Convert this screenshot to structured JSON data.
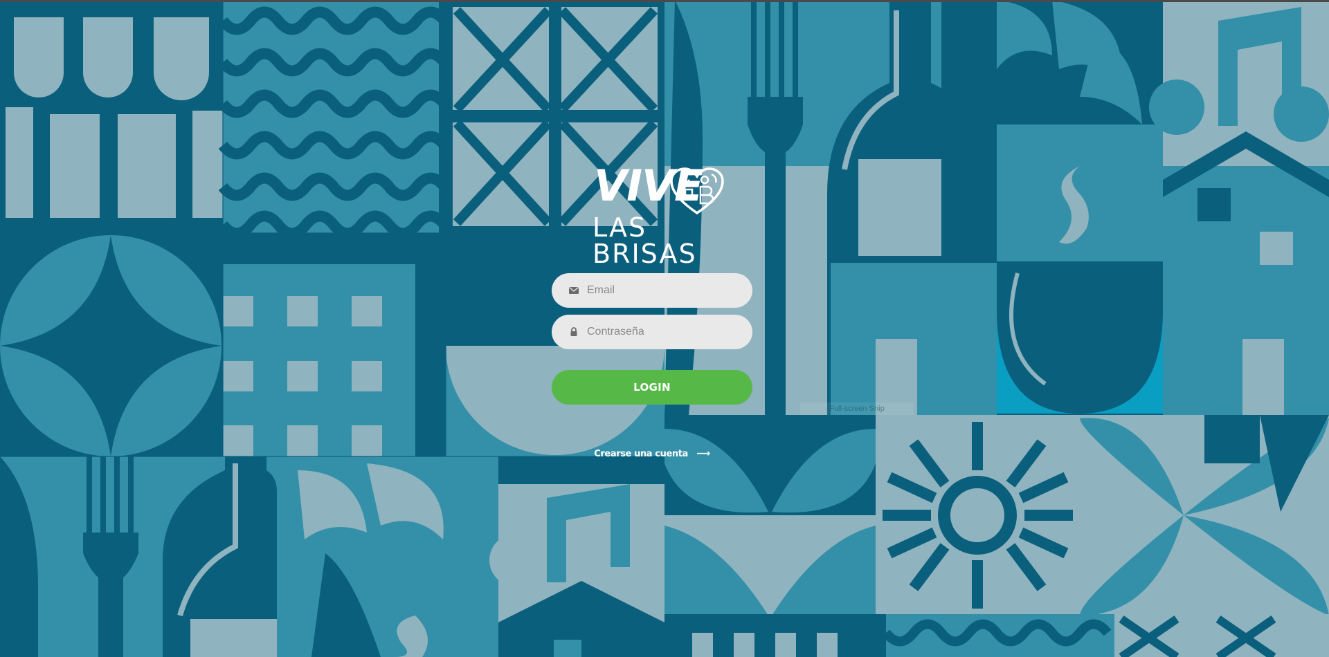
{
  "brand": {
    "logo_line1": "VIVE",
    "logo_line2": "LAS BRISAS"
  },
  "form": {
    "email_placeholder": "Email",
    "email_value": "",
    "email_icon": "envelope-icon",
    "password_placeholder": "Contraseña",
    "password_value": "",
    "password_icon": "lock-icon",
    "login_label": "LOGIN",
    "create_account_label": "Crearse una cuenta",
    "create_account_icon": "arrow-right-icon"
  },
  "overlay": {
    "snip_label": "Full-screen Snip"
  },
  "colors": {
    "background_dark": "#0a5f7d",
    "background_mid": "#3390a8",
    "background_light": "#8fb3bf",
    "input_bg": "#e9e9e9",
    "login_button": "#56b947",
    "text_white": "#ffffff"
  }
}
